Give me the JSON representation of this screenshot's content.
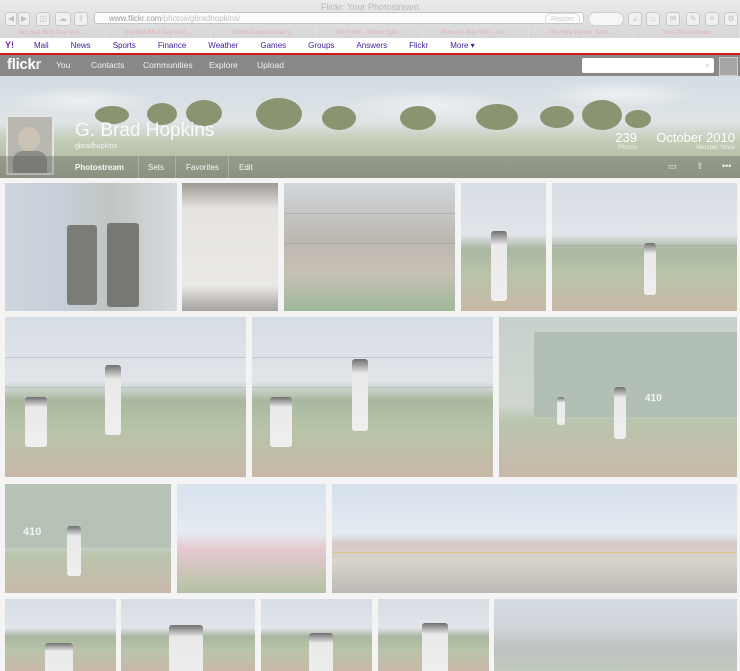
{
  "window": {
    "title": "Flickr: Your Photostream"
  },
  "browser": {
    "url_domain": "www.flickr.com",
    "url_path": "/photos/gbradhopkins/",
    "reader": "Reader",
    "tabs": [
      "Big Bad BBQ Day at N…",
      "Big Bad BBQ Day at N…",
      "Sobre Cuatro Letras |…",
      "Set Flickr - Yahoo! Spo…",
      "How Are We Flickr - Ya…",
      "The Help Forum: Sets…",
      "Your Photostream"
    ]
  },
  "yahoo_bar": {
    "logo": "Y!",
    "items": [
      "Mail",
      "News",
      "Sports",
      "Finance",
      "Weather",
      "Games",
      "Groups",
      "Answers",
      "Flickr",
      "More ▾"
    ]
  },
  "flickr_nav": {
    "logo_main": "flick",
    "logo_r": "r",
    "items": [
      "You",
      "Contacts",
      "Communities",
      "Explore",
      "Upload"
    ]
  },
  "profile": {
    "name": "G. Brad Hopkins",
    "username": "gbradhopkins",
    "photos_count": "239",
    "photos_label": "Photos",
    "member_since": "October 2010",
    "member_label": "Member Since"
  },
  "subnav": {
    "tabs": [
      "Photostream",
      "Sets",
      "Favorites",
      "Edit"
    ],
    "icons": [
      "slideshow-icon",
      "share-icon",
      "more-icon"
    ],
    "icon_glyphs": [
      "▭",
      "⇪",
      "•••"
    ]
  },
  "photos": [
    {
      "name": "two-men-office-photo",
      "text": ""
    },
    {
      "name": "paper-sheet-photo",
      "text": ""
    },
    {
      "name": "dugout-players-photo",
      "text": ""
    },
    {
      "name": "pitcher-closeup-photo",
      "text": ""
    },
    {
      "name": "pitcher-field-photo",
      "text": ""
    },
    {
      "name": "batter-catcher-photo-1",
      "text": ""
    },
    {
      "name": "batter-catcher-photo-2",
      "text": ""
    },
    {
      "name": "outfield-wall-photo",
      "text": "410"
    },
    {
      "name": "fielder-410-photo",
      "text": "410"
    },
    {
      "name": "orchard-photo",
      "text": ""
    },
    {
      "name": "panorama-road-photo",
      "text": ""
    },
    {
      "name": "player-portrait-1",
      "text": ""
    },
    {
      "name": "player-portrait-2",
      "text": ""
    },
    {
      "name": "player-portrait-3",
      "text": ""
    },
    {
      "name": "player-portrait-4",
      "text": ""
    },
    {
      "name": "stadium-stands-photo",
      "text": ""
    }
  ]
}
